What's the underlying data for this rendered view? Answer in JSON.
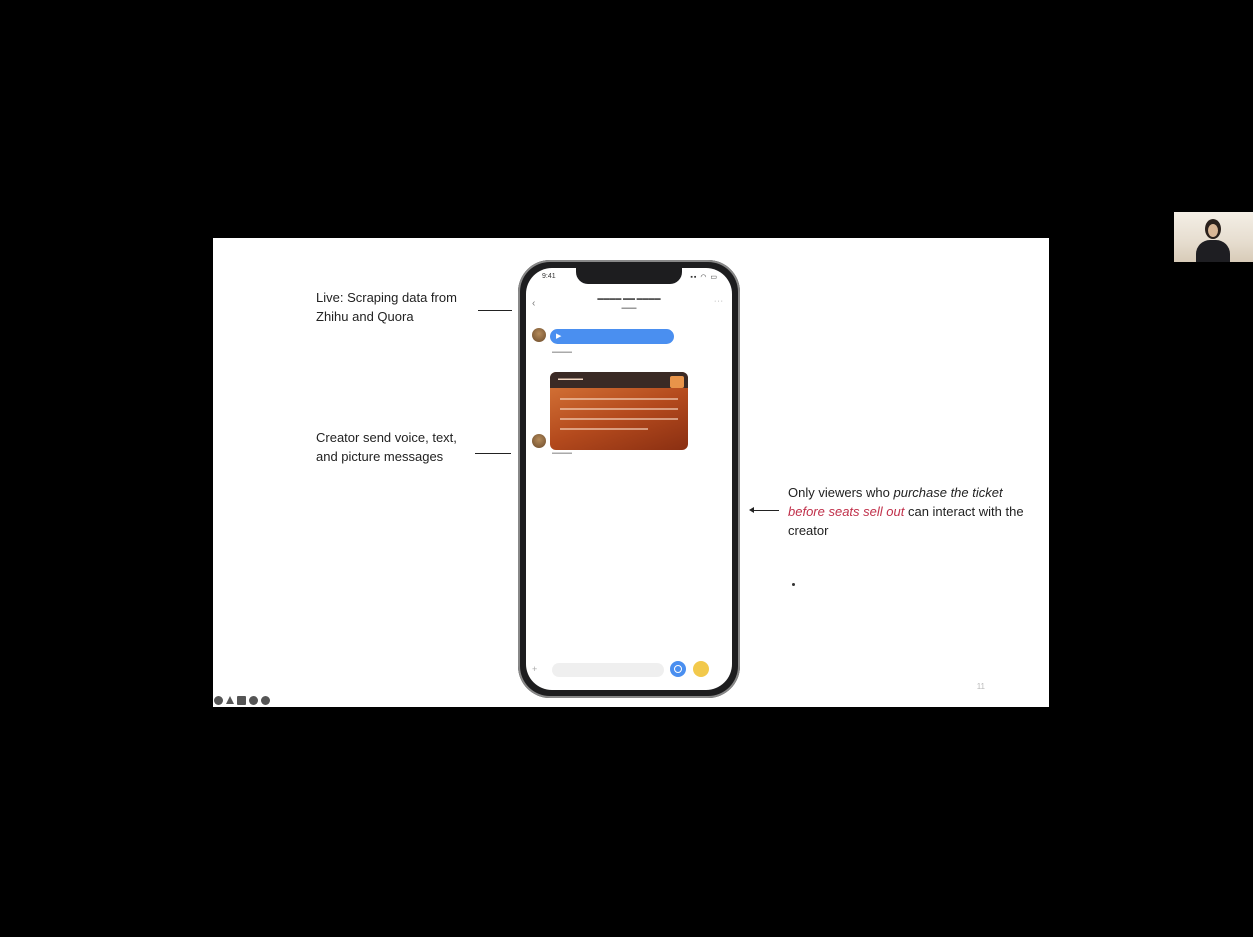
{
  "slide": {
    "notes": {
      "live_line1": "Live: Scraping data from",
      "live_line2": "Zhihu and Quora",
      "creator_line1": "Creator send voice, text,",
      "creator_line2": "and picture messages",
      "viewers_part1": "Only viewers who ",
      "viewers_italic1": "purchase the ticket",
      "viewers_space": " ",
      "viewers_red": "before seats sell out",
      "viewers_part2": " can interact with the creator"
    },
    "page_number": "11"
  },
  "phone": {
    "status_time": "9:41",
    "status_icons": "▪▪ ◠ ▭",
    "back_icon": "‹",
    "more_icon": "···",
    "plus_icon": "+"
  },
  "toolbar": {
    "icons": [
      "pointer-icon",
      "pen-icon",
      "grid-icon",
      "zoom-icon",
      "options-icon"
    ]
  },
  "colors": {
    "background": "#000000",
    "slide": "#ffffff",
    "highlight_red": "#c0304a",
    "voice_bubble": "#4a8ff0"
  }
}
